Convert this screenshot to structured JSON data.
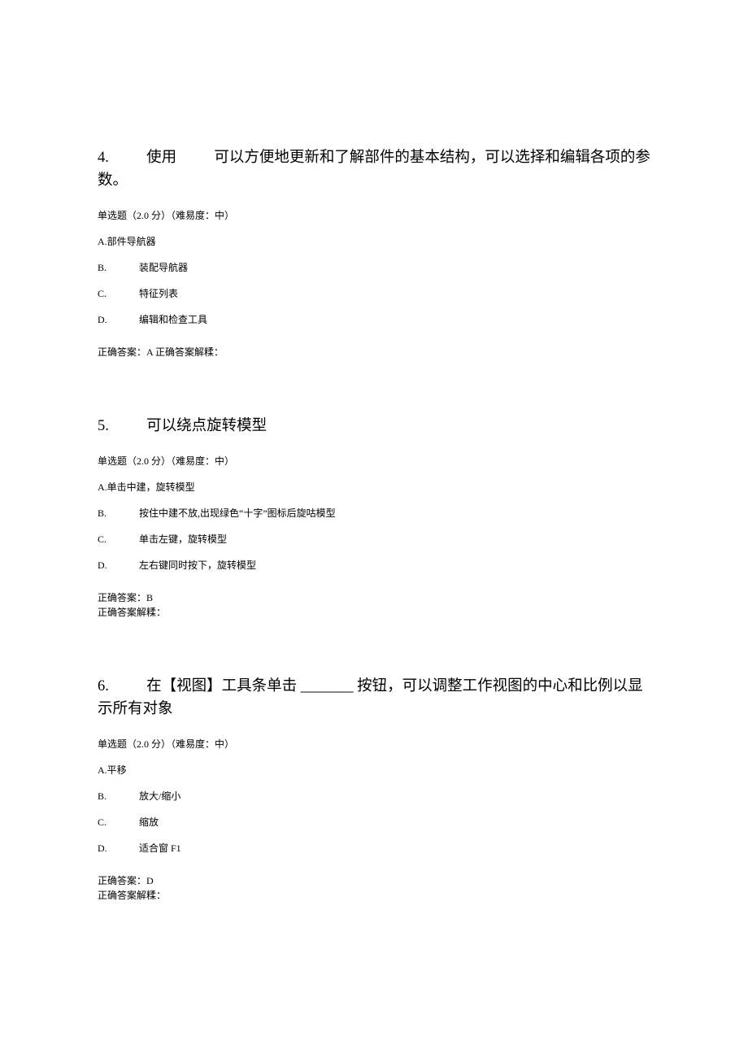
{
  "questions": [
    {
      "number": "4.",
      "title_pre": "使用",
      "title_gap": "　　",
      "title_post": "可以方便地更新和了解部件的基本结构，可以选择和编辑各项的参数。",
      "meta": "单选题（2.0 分）（难易度：中）",
      "optA": "Α.部件导航器",
      "opts": [
        {
          "letter": "B.",
          "text": "装配导航器"
        },
        {
          "letter": "C.",
          "text": "特征列表"
        },
        {
          "letter": "D.",
          "text": "编辑和检查工具"
        }
      ],
      "answer_inline": "正确答案：A 正确答案解糅："
    },
    {
      "number": "5.",
      "title_plain": "可以绕点旋转模型",
      "meta": "单选题（2.0 分）（难易度：中）",
      "optA": "Α.单击中建，旋转模型",
      "opts": [
        {
          "letter": "B.",
          "text": "按住中建不放,出现绿色“十字”图标后旋咕模型"
        },
        {
          "letter": "C.",
          "text": "单击左键，旋转模型"
        },
        {
          "letter": "D.",
          "text": "左右键同时按下，旋转模型"
        }
      ],
      "answer_line1": "正确答案：B",
      "answer_line2": "正确答案解糅："
    },
    {
      "number": "6.",
      "title_pre": "在【视图】工具条单击 ",
      "title_blank": "_______",
      "title_post": "按钮，可以调整工作视图的中心和比例以显示所有对象",
      "meta": "单选题（2.0 分）（难易度：中）",
      "optA": "Α.平移",
      "opts": [
        {
          "letter": "B.",
          "text": "放大/缩小"
        },
        {
          "letter": "C.",
          "text": "缩放"
        },
        {
          "letter": "D.",
          "text": "适合窗 F1"
        }
      ],
      "answer_line1": "正确答案：D",
      "answer_line2": "正确答案解糅："
    }
  ]
}
